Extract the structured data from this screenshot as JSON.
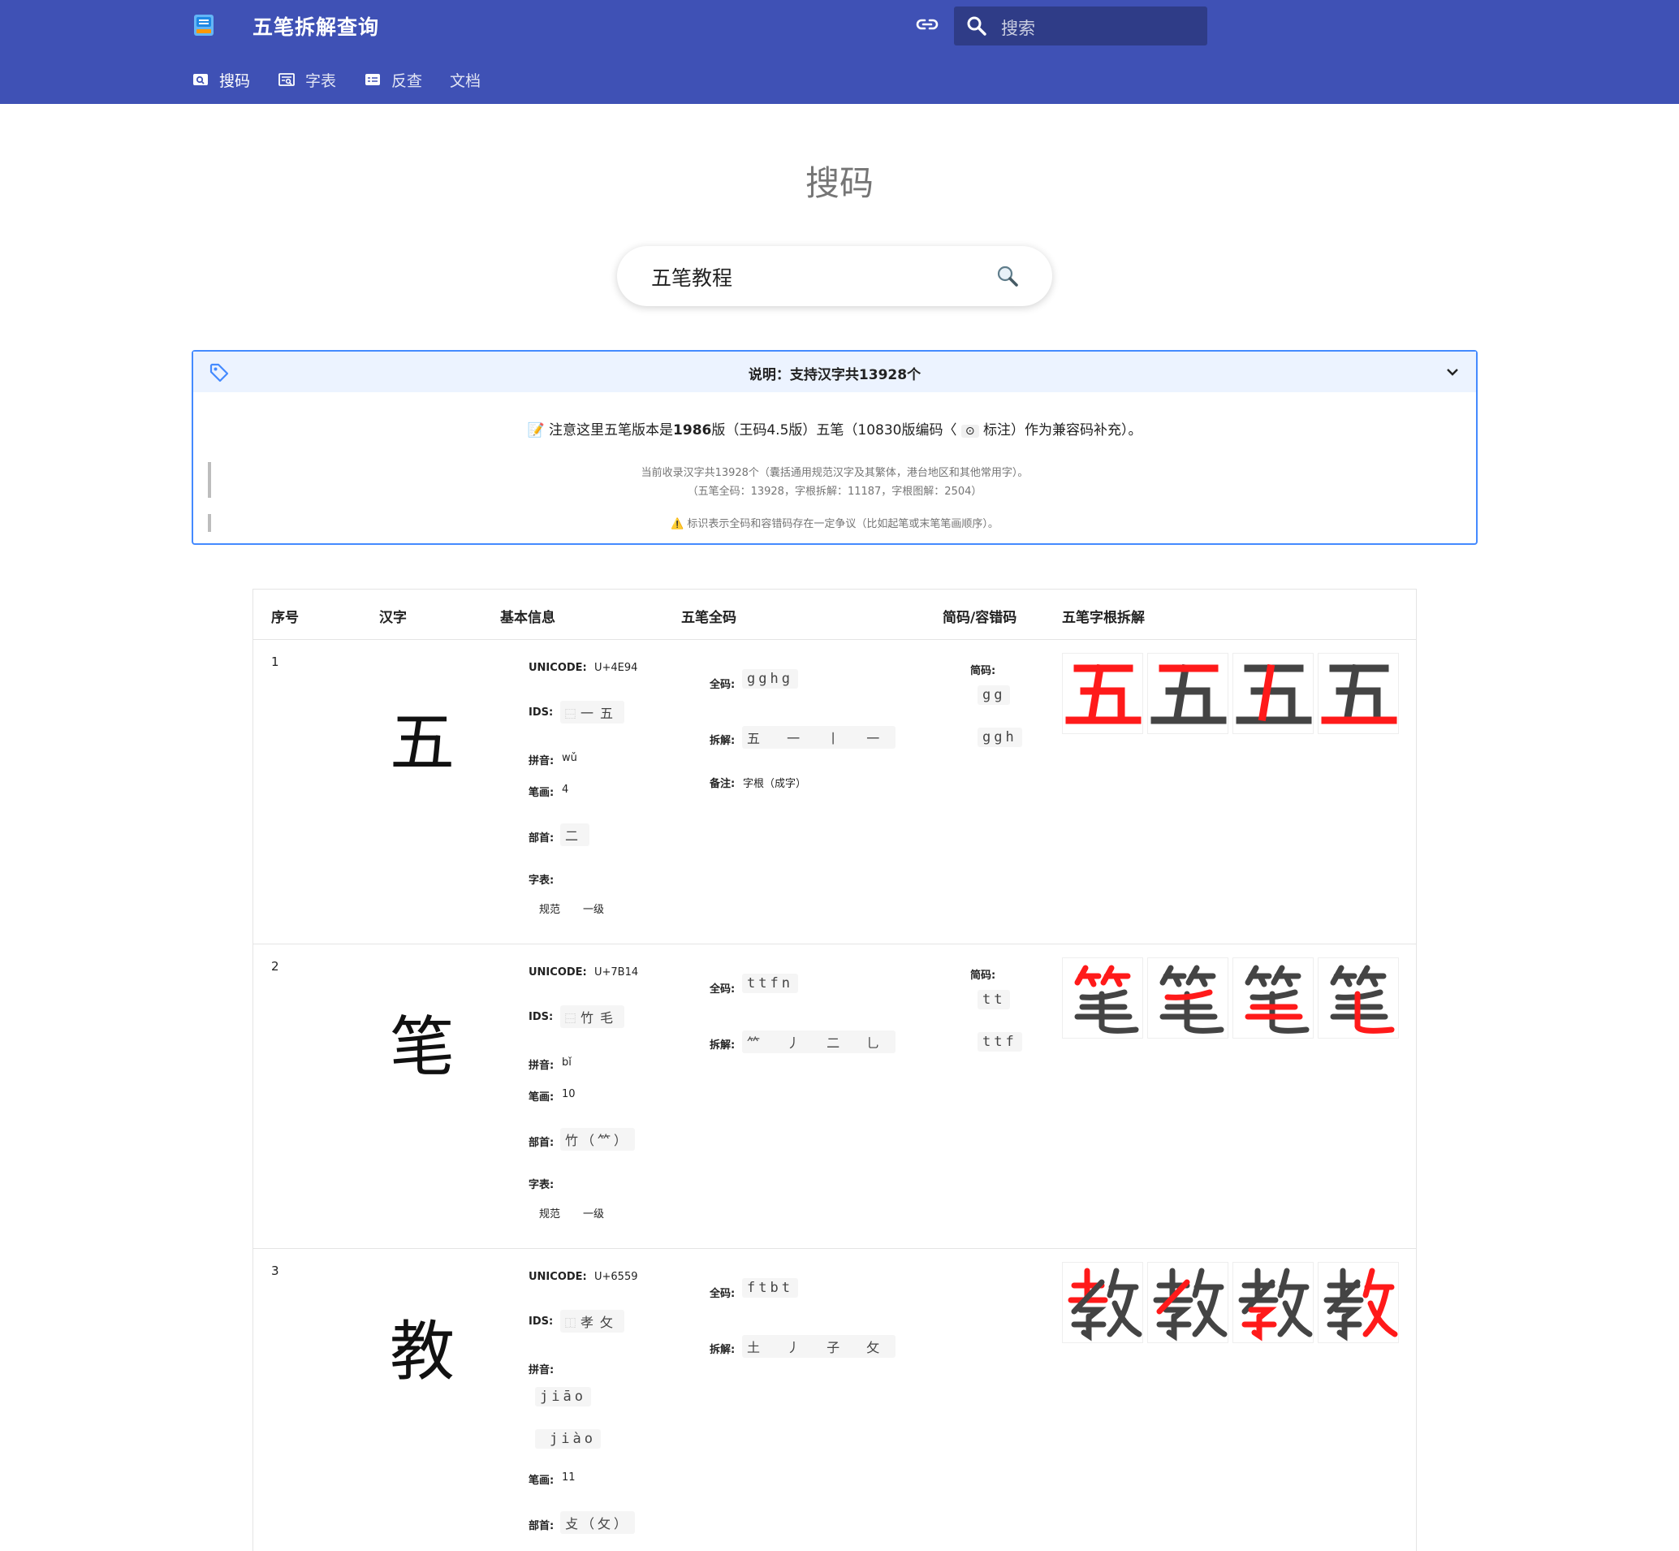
{
  "header": {
    "site_title": "五笔拆解查询",
    "search_placeholder": "搜索",
    "nav": [
      {
        "label": "搜码",
        "active": true
      },
      {
        "label": "字表",
        "active": false
      },
      {
        "label": "反查",
        "active": false
      },
      {
        "label": "文档",
        "active": false
      }
    ]
  },
  "page": {
    "title": "搜码",
    "query": "五笔教程"
  },
  "notice": {
    "title": "说明：支持汉字共13928个",
    "line1_pre": "📝 注意这里五笔版本是",
    "line1_bold": "1986",
    "line1_mid": "版（王码4.5版）五笔（10830版编码〈",
    "line1_badge": "⊙",
    "line1_post": "标注）作为兼容码补充）。",
    "line2": "当前收录汉字共13928个（囊括通用规范汉字及其繁体，港台地区和其他常用字）。",
    "line3": "（五笔全码：13928，字根拆解：11187，字根图解：2504）",
    "line4": "⚠️ 标识表示全码和容错码存在一定争议（比如起笔或末笔笔画顺序）。"
  },
  "table": {
    "headers": [
      "序号",
      "汉字",
      "基本信息",
      "五笔全码",
      "简码/容错码",
      "五笔字根拆解"
    ],
    "labels": {
      "unicode": "UNICODE:",
      "ids": "IDS:",
      "pinyin": "拼音:",
      "strokes": "笔画:",
      "radical": "部首:",
      "charset": "字表:",
      "full": "全码:",
      "split": "拆解:",
      "note": "备注:",
      "short": "简码:"
    },
    "rows": [
      {
        "index": "1",
        "char": "五",
        "unicode": "U+4E94",
        "ids_mark": "⿱",
        "ids": "一五",
        "pinyin": [
          "wǔ"
        ],
        "strokes": "4",
        "radical": "二",
        "charset": [
          "规范",
          "一级"
        ],
        "full_code": "gghg",
        "split": "五 一 丨 一",
        "note": "字根（成字）",
        "short_codes": [
          "gg",
          "ggh"
        ]
      },
      {
        "index": "2",
        "char": "笔",
        "unicode": "U+7B14",
        "ids_mark": "⿱",
        "ids": "竹毛",
        "pinyin": [
          "bǐ"
        ],
        "strokes": "10",
        "radical": "竹（⺮）",
        "charset": [
          "规范",
          "一级"
        ],
        "full_code": "ttfn",
        "split": "⺮ 丿 二 乚",
        "note": "",
        "short_codes": [
          "tt",
          "ttf"
        ]
      },
      {
        "index": "3",
        "char": "教",
        "unicode": "U+6559",
        "ids_mark": "⿰",
        "ids": "孝攵",
        "pinyin": [
          "jiāo",
          "jiào"
        ],
        "strokes": "11",
        "radical": "攴（攵）",
        "charset": [],
        "full_code": "ftbt",
        "split": "土 丿 子 攵",
        "note": "",
        "short_codes": []
      }
    ]
  },
  "colors": {
    "primary": "#3f51b5",
    "accent": "#448aff",
    "highlight": "#ff1a1a"
  }
}
